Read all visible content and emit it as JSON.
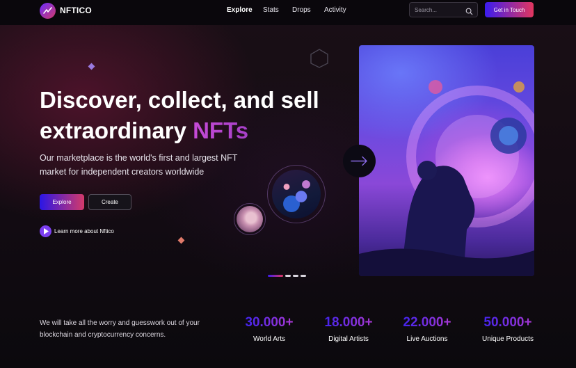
{
  "brand": {
    "name": "NFTICO"
  },
  "nav": {
    "links": [
      {
        "label": "Explore",
        "active": true
      },
      {
        "label": "Stats",
        "active": false
      },
      {
        "label": "Drops",
        "active": false
      },
      {
        "label": "Activity",
        "active": false
      }
    ],
    "search_placeholder": "Search...",
    "cta_label": "Get in Touch"
  },
  "hero": {
    "title_line1": "Discover, collect, and sell",
    "title_line2_prefix": "extraordinary ",
    "title_line2_accent": "NFTs",
    "subtitle": "Our marketplace is the world's first and largest NFT market for independent creators worldwide",
    "explore_label": "Explore",
    "create_label": "Create",
    "learn_more_label": "Learn more about Nftico"
  },
  "carousel": {
    "slide_count": 4,
    "active_index": 0
  },
  "stats": {
    "intro": "We will take all the worry and guesswork out of your blockchain and cryptocurrency concerns.",
    "items": [
      {
        "value": "30.000+",
        "label": "World Arts"
      },
      {
        "value": "18.000+",
        "label": "Digital Artists"
      },
      {
        "value": "22.000+",
        "label": "Live Auctions"
      },
      {
        "value": "50.000+",
        "label": "Unique Products"
      }
    ]
  },
  "colors": {
    "accent_blue": "#3a1cf0",
    "accent_pink": "#e2365e",
    "accent_purple": "#c64bd6",
    "background": "#0d0a10"
  },
  "icons": [
    "logo-icon",
    "search-icon",
    "play-icon",
    "arrow-right-icon",
    "hexagon-icon",
    "diamond-icon"
  ]
}
